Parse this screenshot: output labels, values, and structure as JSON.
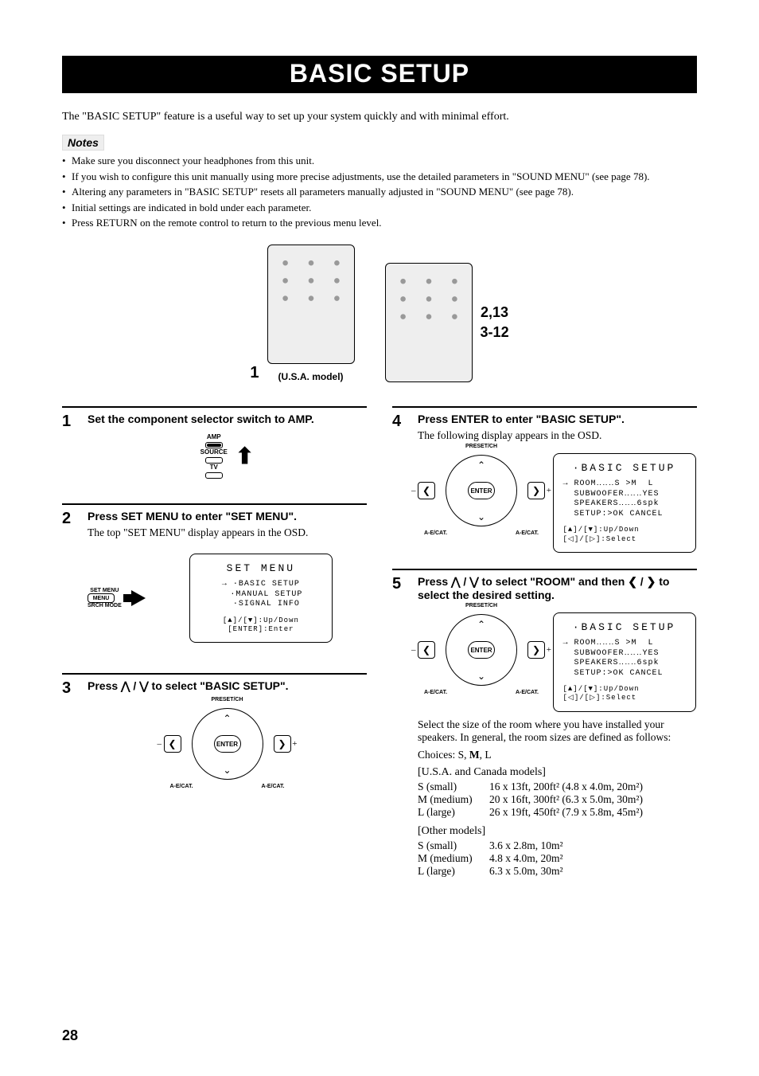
{
  "title": "BASIC SETUP",
  "intro": "The \"BASIC SETUP\" feature is a useful way to set up your system quickly and with minimal effort.",
  "notes_label": "Notes",
  "notes": [
    "Make sure you disconnect your headphones from this unit.",
    "If you wish to configure this unit manually using more precise adjustments, use the detailed parameters in \"SOUND MENU\" (see page 78).",
    "Altering any parameters in \"BASIC SETUP\" resets all parameters manually adjusted in \"SOUND MENU\" (see page 78).",
    "Initial settings are indicated in bold under each parameter.",
    "Press RETURN on the remote control to return to the previous menu level."
  ],
  "remote": {
    "left_num": "1",
    "right_nums": [
      "2,13",
      "3-12"
    ],
    "caption": "(U.S.A. model)"
  },
  "amp_labels": {
    "amp": "AMP",
    "source": "SOURCE",
    "tv": "TV"
  },
  "setmenu_labels": {
    "setmenu": "SET MENU",
    "menu": "MENU",
    "srch": "SRCH MODE"
  },
  "navpad": {
    "enter": "ENTER",
    "top": "PRESET/CH",
    "bottom": "A-E/CAT.",
    "minus": "–",
    "plus": "+",
    "left": "❮",
    "right": "❯",
    "up": "⌃",
    "down": "⌄"
  },
  "osd_setmenu": {
    "title": "SET MENU",
    "lines": [
      "→ ·BASIC SETUP",
      "  ·MANUAL SETUP",
      "  ·SIGNAL INFO"
    ],
    "hints": [
      "[▲]/[▼]:Up/Down",
      "[ENTER]:Enter"
    ]
  },
  "osd_basic": {
    "title": "·BASIC SETUP",
    "lines": [
      "→ ROOM‥‥‥S >M  L",
      "  SUBWOOFER‥‥‥YES",
      "  SPEAKERS‥‥‥6spk",
      "  SETUP:>OK CANCEL"
    ],
    "hints": [
      "[▲]/[▼]:Up/Down",
      "[◁]/[▷]:Select"
    ]
  },
  "steps": {
    "s1": {
      "num": "1",
      "title": "Set the component selector switch to AMP."
    },
    "s2": {
      "num": "2",
      "title": "Press SET MENU to enter \"SET MENU\".",
      "sub": "The top \"SET MENU\" display appears in the OSD."
    },
    "s3": {
      "num": "3",
      "title": "Press ⋀ / ⋁ to select \"BASIC SETUP\"."
    },
    "s4": {
      "num": "4",
      "title": "Press ENTER to enter \"BASIC SETUP\".",
      "sub": "The following display appears in the OSD."
    },
    "s5": {
      "num": "5",
      "title": "Press ⋀ / ⋁ to select \"ROOM\" and then ❮ / ❯ to select the desired setting.",
      "sub": "Select the size of the room where you have installed your speakers. In general, the room sizes are defined as follows:"
    }
  },
  "choices_line": "Choices: S, M, L",
  "dims_us_head": "[U.S.A. and Canada models]",
  "dims_us": [
    {
      "label": "S (small)",
      "val": "16 x 13ft, 200ft² (4.8 x 4.0m, 20m²)"
    },
    {
      "label": "M (medium)",
      "val": "20 x 16ft, 300ft² (6.3 x 5.0m, 30m²)"
    },
    {
      "label": "L (large)",
      "val": "26 x 19ft, 450ft² (7.9 x 5.8m, 45m²)"
    }
  ],
  "dims_other_head": "[Other models]",
  "dims_other": [
    {
      "label": "S (small)",
      "val": "3.6 x 2.8m, 10m²"
    },
    {
      "label": "M (medium)",
      "val": "4.8 x 4.0m, 20m²"
    },
    {
      "label": "L (large)",
      "val": "6.3 x 5.0m, 30m²"
    }
  ],
  "page_number": "28"
}
